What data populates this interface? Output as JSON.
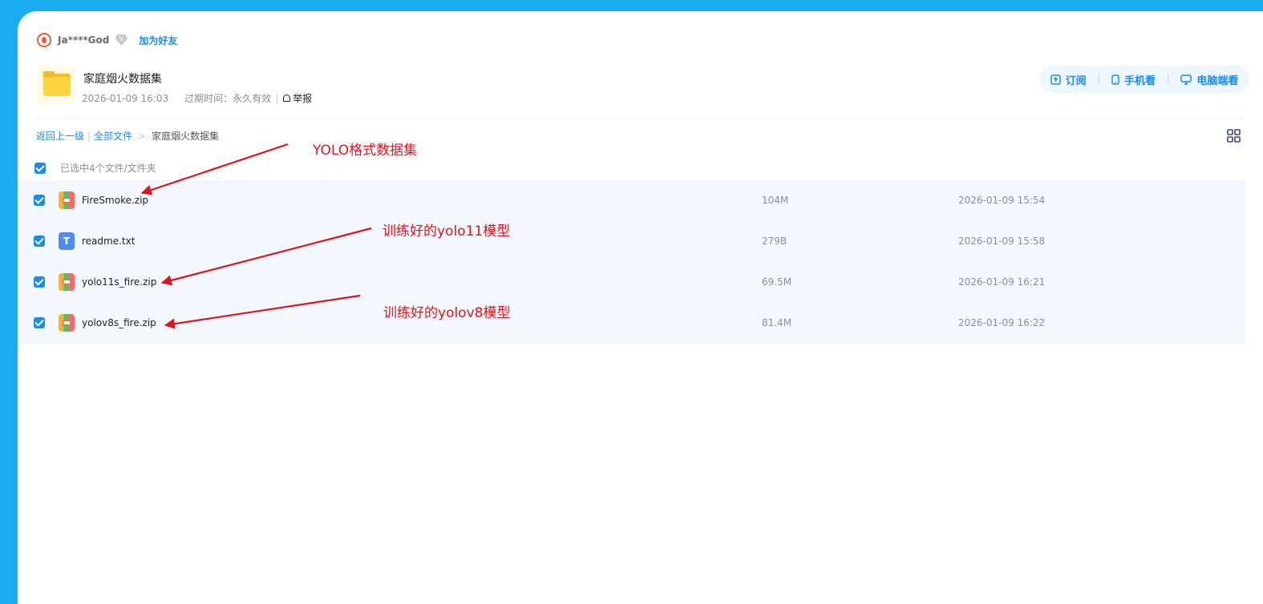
{
  "user": {
    "name": "Ja****God",
    "vip_badge": "V",
    "add_friend_label": "加为好友"
  },
  "share": {
    "title": "家庭烟火数据集",
    "created": "2026-01-09 16:03",
    "expiry_label": "过期时间：",
    "expiry_value": "永久有效",
    "report_label": "举报"
  },
  "actions": {
    "subscribe_label": "订阅",
    "mobile_label": "手机看",
    "desktop_label": "电脑端看"
  },
  "breadcrumb": {
    "back_label": "返回上一级",
    "root_label": "全部文件",
    "arrow": ">",
    "current_label": "家庭烟火数据集"
  },
  "selection": {
    "summary": "已选中4个文件/文件夹"
  },
  "files": [
    {
      "name": "FireSmoke.zip",
      "type": "zip-icon",
      "size": "104M",
      "modified": "2026-01-09 15:54",
      "checked": true
    },
    {
      "name": "readme.txt",
      "type": "txt-icon",
      "size": "279B",
      "modified": "2026-01-09 15:58",
      "checked": true
    },
    {
      "name": "yolo11s_fire.zip",
      "type": "zip-icon",
      "size": "69.5M",
      "modified": "2026-01-09 16:21",
      "checked": true
    },
    {
      "name": "yolov8s_fire.zip",
      "type": "zip-icon",
      "size": "81.4M",
      "modified": "2026-01-09 16:22",
      "checked": true
    }
  ],
  "annotations": [
    {
      "text": "YOLO格式数据集"
    },
    {
      "text": "训练好的yolo11模型"
    },
    {
      "text": "训练好的yolov8模型"
    }
  ],
  "colors": {
    "background": "#1aabf0",
    "accent": "#1a8cf0",
    "annotation": "#e0141c"
  }
}
